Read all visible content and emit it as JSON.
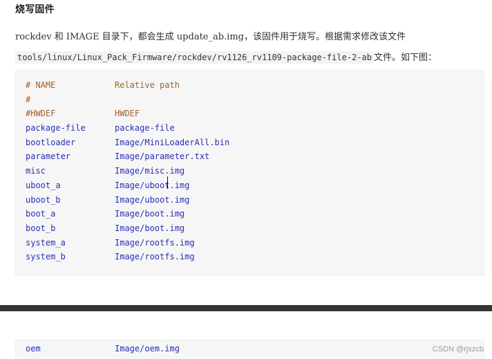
{
  "section": {
    "title": "烧写固件"
  },
  "description": {
    "line1": "rockdev 和 IMAGE 目录下，都会生成 update_ab.img，该固件用于烧写。根据需求修改该文件",
    "path": "tools/linux/Linux_Pack_Firmware/rockdev/rv1126_rv1109-package-file-2-ab",
    "line2_suffix": "文件。如下图："
  },
  "code_block": {
    "header": [
      {
        "key": "# NAME",
        "value": "Relative path"
      },
      {
        "key": "#",
        "value": ""
      },
      {
        "key": "#HWDEF",
        "value": "HWDEF"
      }
    ],
    "rows": [
      {
        "key": "package-file",
        "value": "package-file"
      },
      {
        "key": "bootloader",
        "value": "Image/MiniLoaderAll.bin"
      },
      {
        "key": "parameter",
        "value": "Image/parameter.txt"
      },
      {
        "key": "misc",
        "value": "Image/misc.img"
      },
      {
        "key": "uboot_a",
        "value": "Image/uboot.img"
      },
      {
        "key": "uboot_b",
        "value": "Image/uboot.img"
      },
      {
        "key": "boot_a",
        "value": "Image/boot.img"
      },
      {
        "key": "boot_b",
        "value": "Image/boot.img"
      },
      {
        "key": "system_a",
        "value": "Image/rootfs.img"
      },
      {
        "key": "system_b",
        "value": "Image/rootfs.img"
      }
    ]
  },
  "code_block_2": {
    "rows": [
      {
        "key": "oem",
        "value": "Image/oem.img"
      }
    ]
  },
  "watermark": "CSDN @rjszcb",
  "colors": {
    "comment": "#a0622d",
    "keyword": "#2a2fb5",
    "code_background": "#f6f6f6",
    "divider": "#343434"
  }
}
